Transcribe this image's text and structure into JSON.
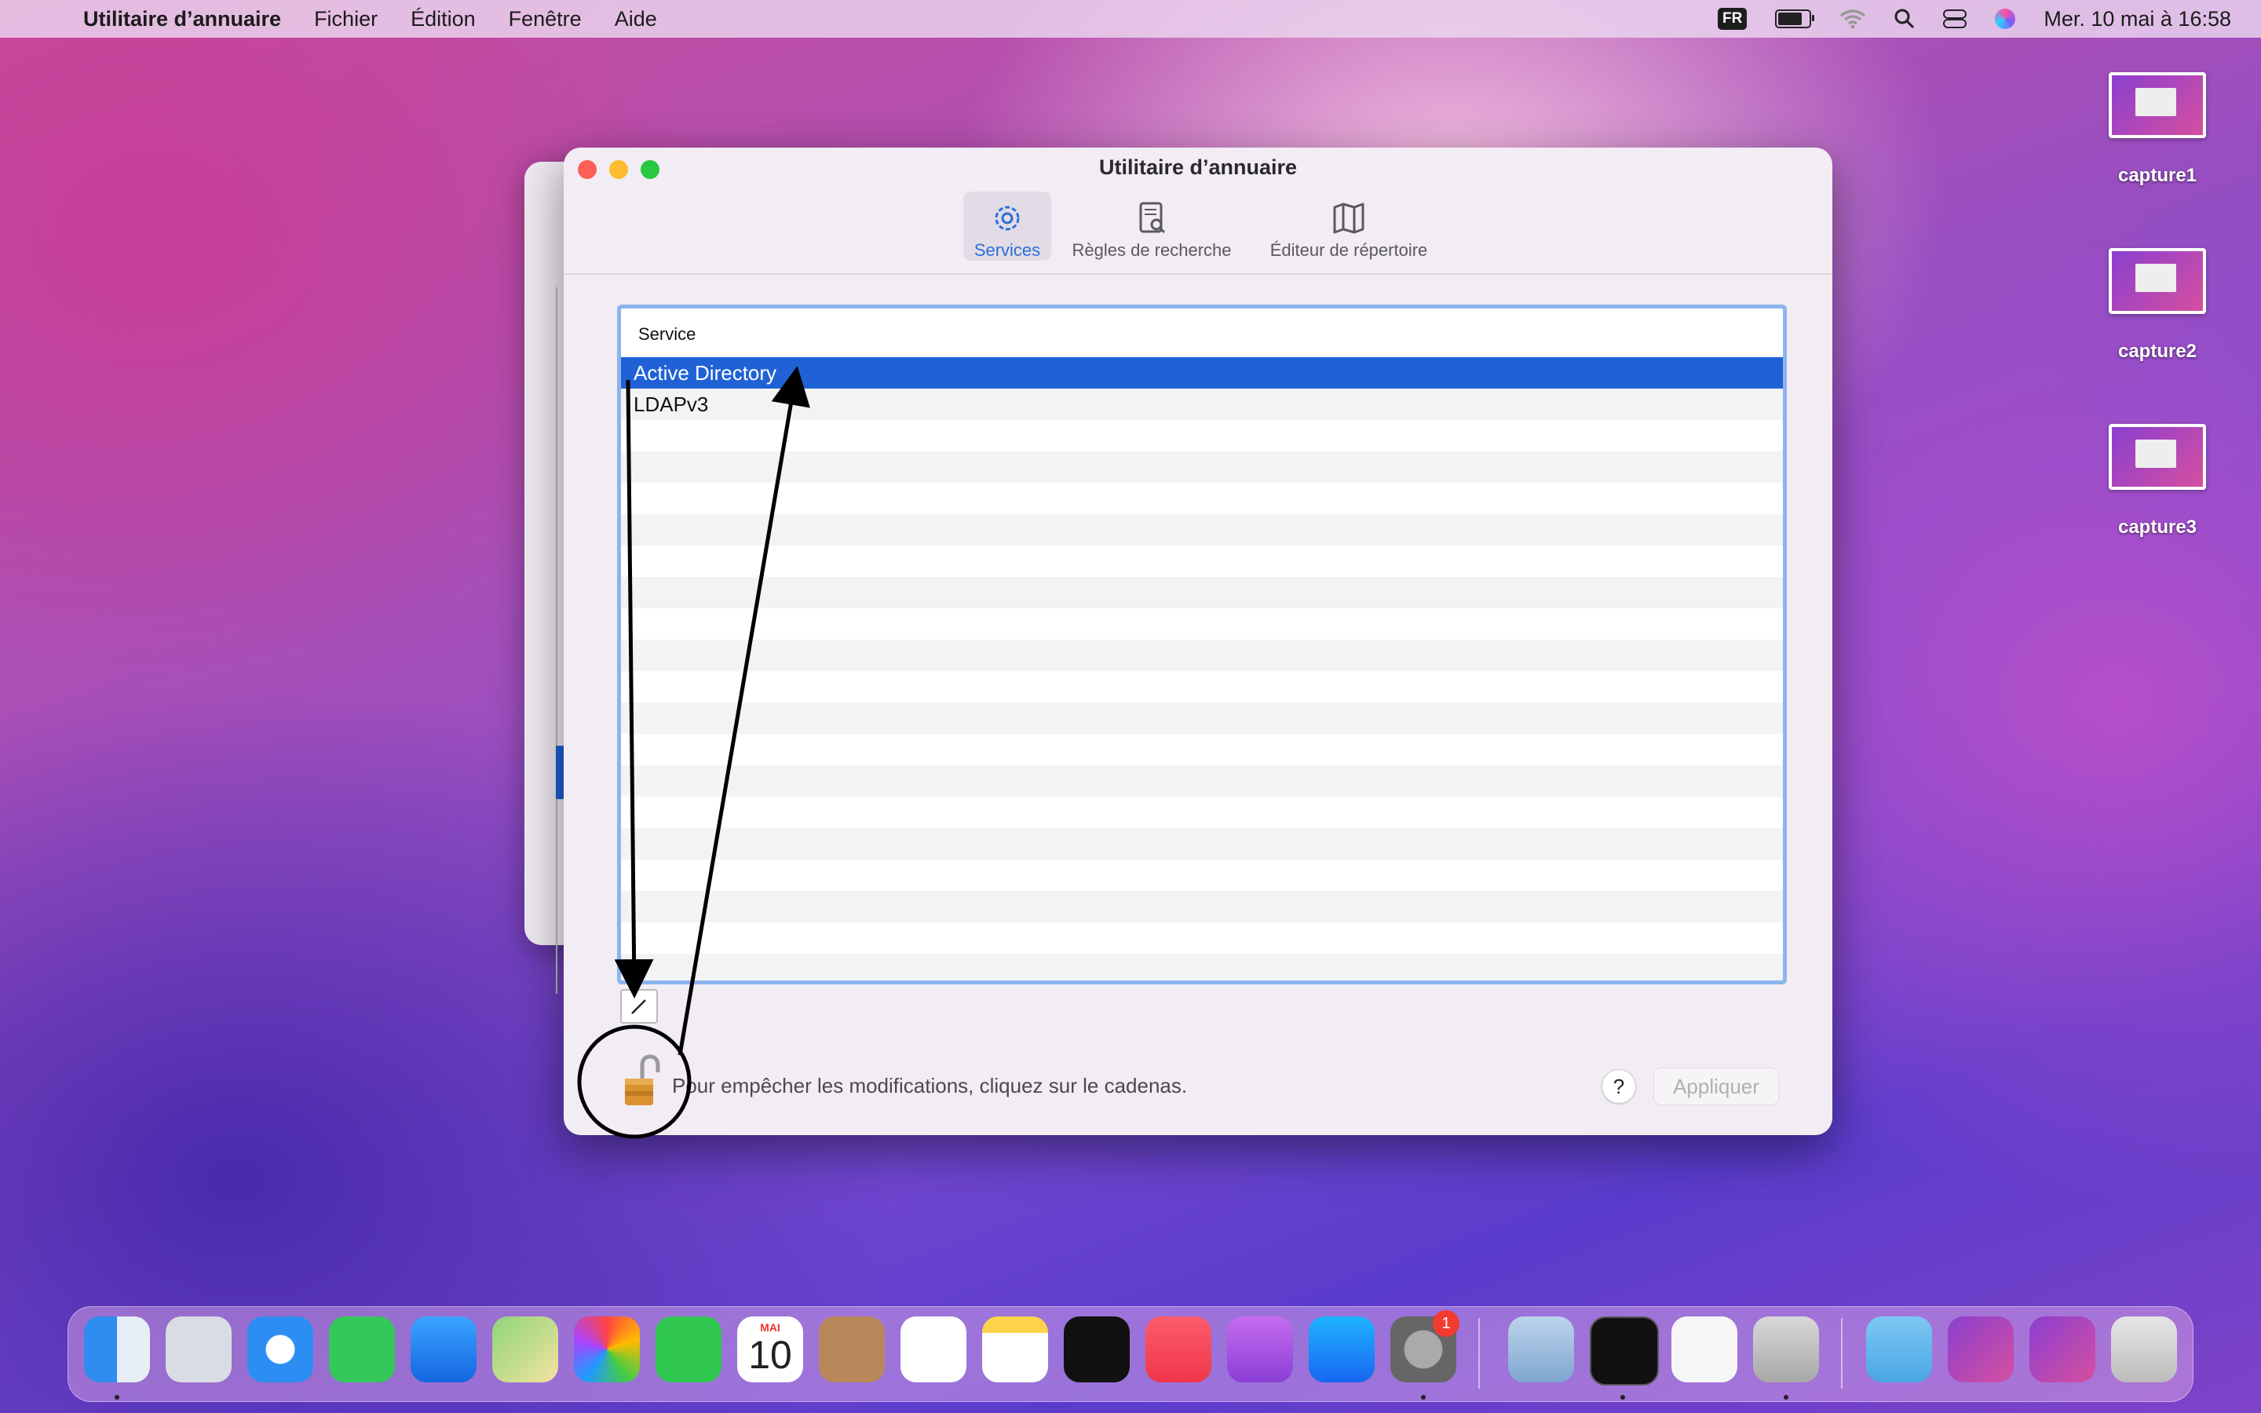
{
  "menubar": {
    "app_name": "Utilitaire d’annuaire",
    "menus": [
      "Fichier",
      "Édition",
      "Fenêtre",
      "Aide"
    ],
    "input_source": "FR",
    "datetime": "Mer. 10 mai à  16:58"
  },
  "window": {
    "title": "Utilitaire d’annuaire",
    "toolbar": {
      "services": "Services",
      "search_rules": "Règles de recherche",
      "directory_editor": "Éditeur de répertoire"
    },
    "table": {
      "column_header": "Service",
      "rows": [
        "Active Directory",
        "LDAPv3"
      ],
      "selected_index": 0
    },
    "footer": {
      "lock_text": "Pour empêcher les modifications, cliquez sur le cadenas.",
      "help_label": "?",
      "apply_label": "Appliquer"
    }
  },
  "desktop": {
    "files": [
      "capture1",
      "capture2",
      "capture3"
    ]
  },
  "dock": {
    "apps": [
      "Finder",
      "Launchpad",
      "Safari",
      "Messages",
      "Mail",
      "Plans",
      "Photos",
      "FaceTime",
      "Calendrier",
      "Contacts",
      "Rappels",
      "Notes",
      "TV",
      "Musique",
      "Podcasts",
      "App Store",
      "Préférences Système",
      "Aperçu",
      "Terminal",
      "TextEdit",
      "Utilitaire d’annuaire",
      "Téléchargements",
      "capture",
      "capture",
      "Corbeille"
    ],
    "calendar_month": "MAI",
    "calendar_day": "10",
    "system_prefs_badge": "1"
  },
  "colors": {
    "accent": "#2062d6",
    "selected_row": "#2062d6",
    "table_focus_ring": "#8cb4ef",
    "annotation": "#000000"
  }
}
